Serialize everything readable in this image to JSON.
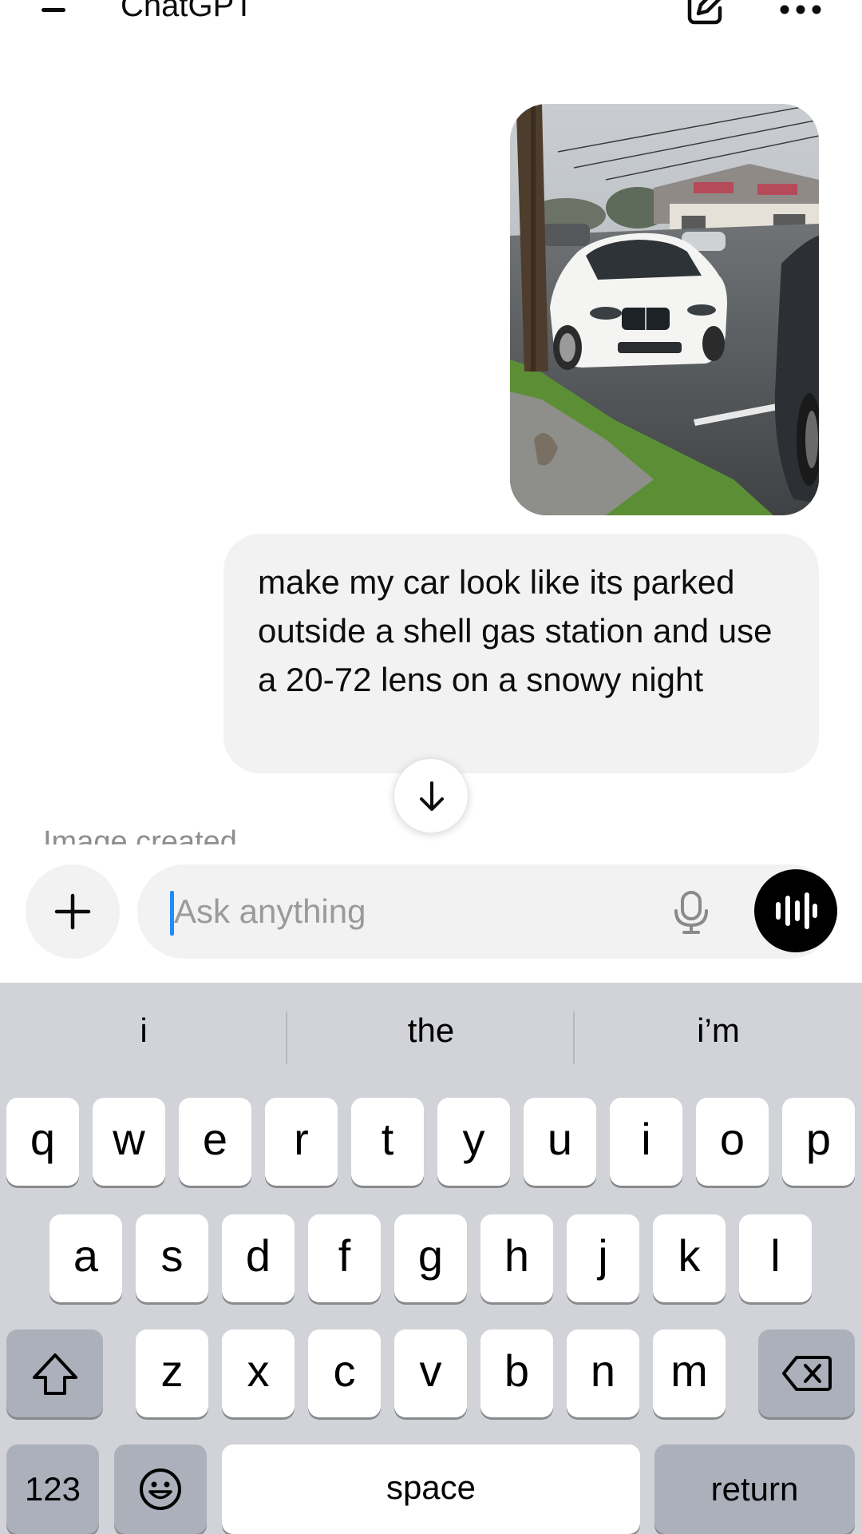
{
  "header": {
    "title": "ChatGPT"
  },
  "chat": {
    "user_image_alt": "white car",
    "user_message": "make my car look like its parked outside a shell gas station and use a 20-72 lens on a snowy night",
    "status_partial": "Image created"
  },
  "composer": {
    "placeholder": "Ask anything"
  },
  "keyboard": {
    "suggestions": [
      "i",
      "the",
      "i’m"
    ],
    "row1": [
      "q",
      "w",
      "e",
      "r",
      "t",
      "y",
      "u",
      "i",
      "o",
      "p"
    ],
    "row2": [
      "a",
      "s",
      "d",
      "f",
      "g",
      "h",
      "j",
      "k",
      "l"
    ],
    "row3": [
      "z",
      "x",
      "c",
      "v",
      "b",
      "n",
      "m"
    ],
    "numbers_label": "123",
    "space_label": "space",
    "return_label": "return"
  },
  "colors": {
    "bubble": "#f2f2f2",
    "keyboard_bg": "#d1d3d9",
    "function_key": "#abb0ba",
    "caret": "#1f8bff"
  }
}
